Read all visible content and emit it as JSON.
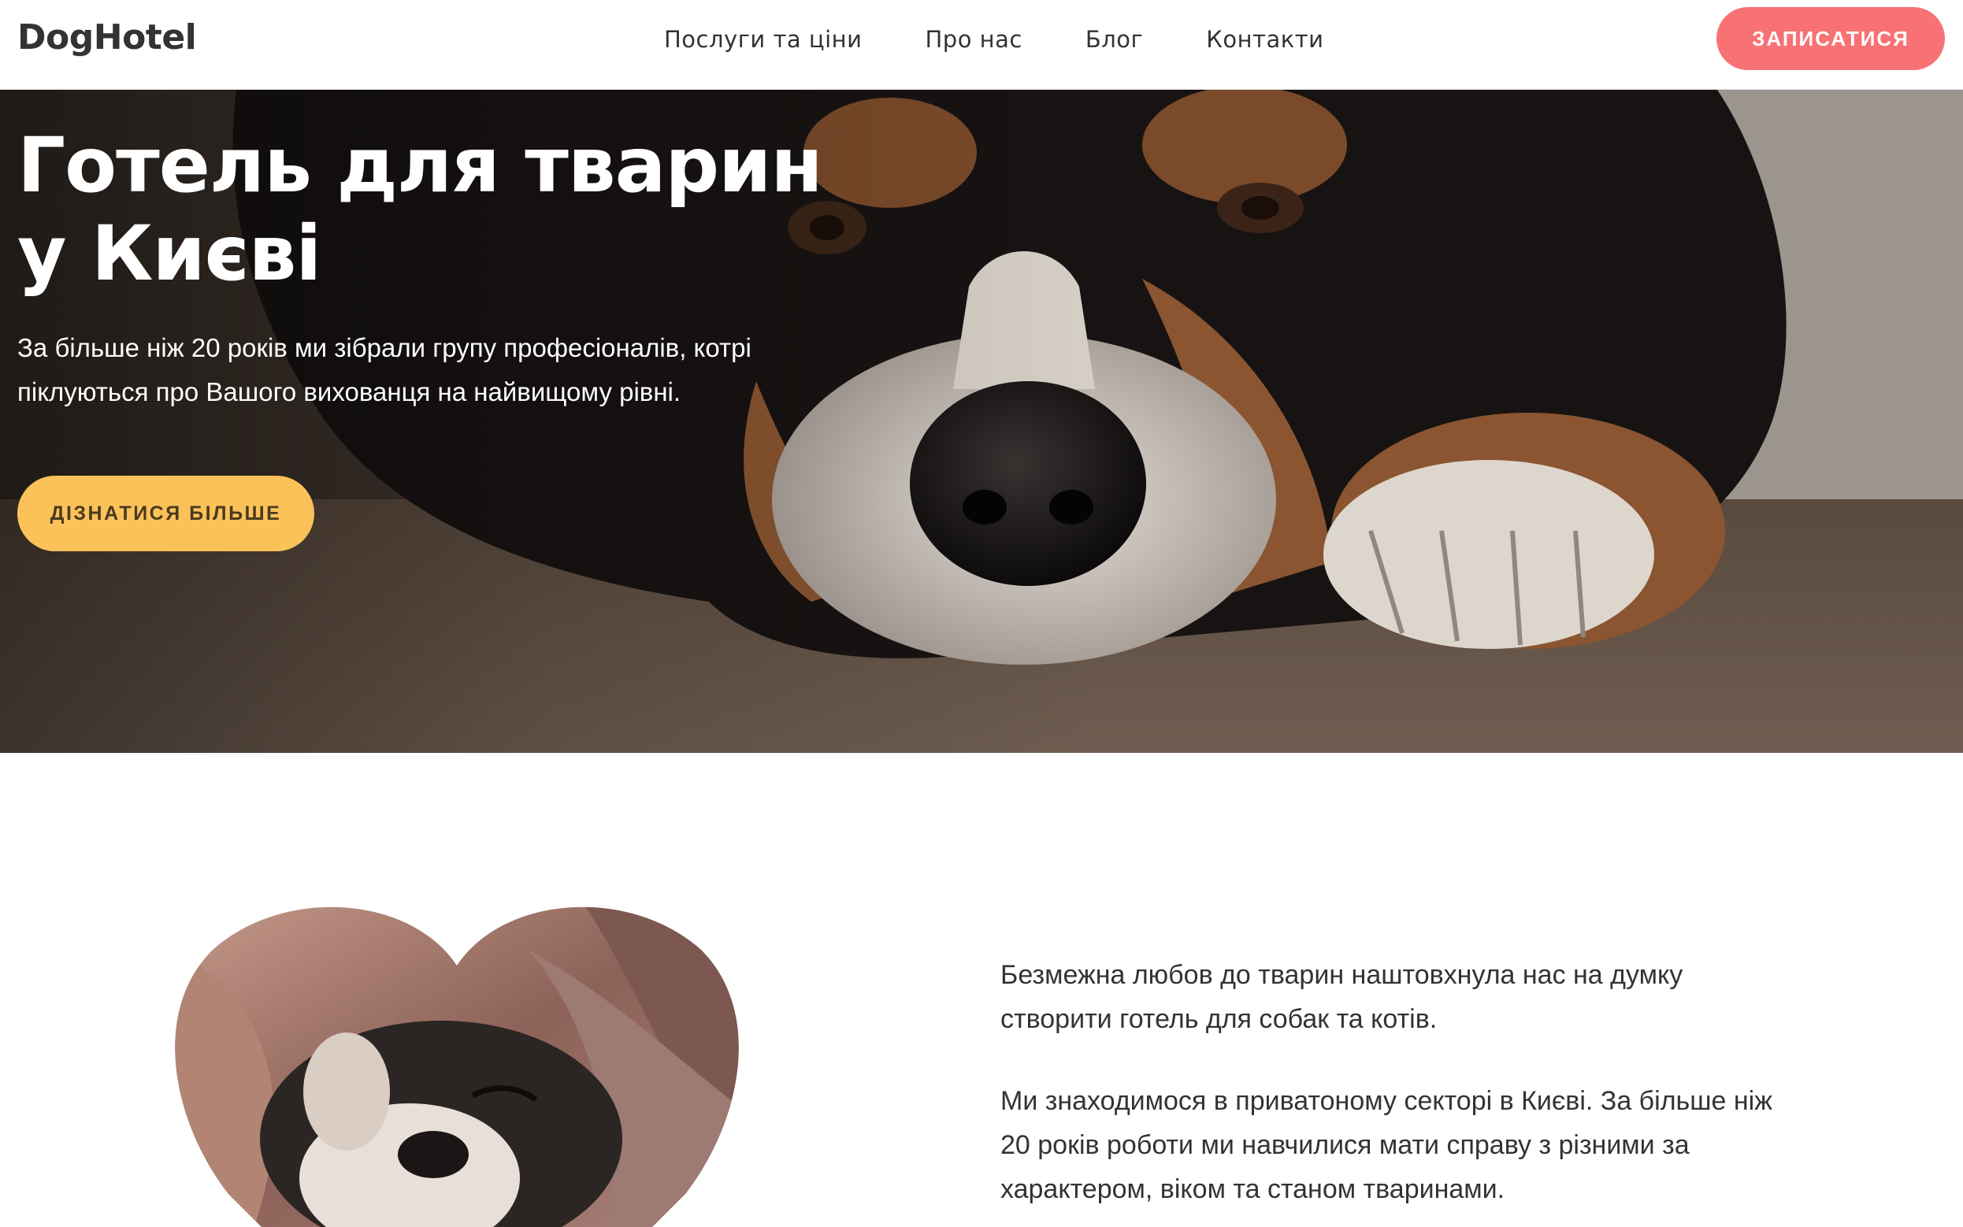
{
  "header": {
    "logo": "DogHotel",
    "nav": [
      {
        "label": "Послуги та ціни"
      },
      {
        "label": "Про нас"
      },
      {
        "label": "Блог"
      },
      {
        "label": "Контакти"
      }
    ],
    "cta_label": "ЗАПИСАТИСЯ"
  },
  "hero": {
    "title": "Готель для тварин у Києві",
    "text": "За більше ніж 20 років ми зібрали групу професіоналів, котрі піклуються про Вашого вихованця на найвищому рівні.",
    "button_label": "ДІЗНАТИСЯ БІЛЬШЕ",
    "image": "dog-resting-photo"
  },
  "about": {
    "image": "puppy-heart-photo",
    "paragraphs": [
      "Безмежна любов до тварин наштовхнула нас на думку створити готель для собак та котів.",
      "Ми знаходимося в приватоному секторі в Києві. За більше ніж 20 років роботи ми навчилися мати справу з різними за характером, віком та станом тваринами."
    ]
  },
  "colors": {
    "signup_button": "#f87174",
    "more_button": "#fbc25a",
    "text": "#333333"
  }
}
